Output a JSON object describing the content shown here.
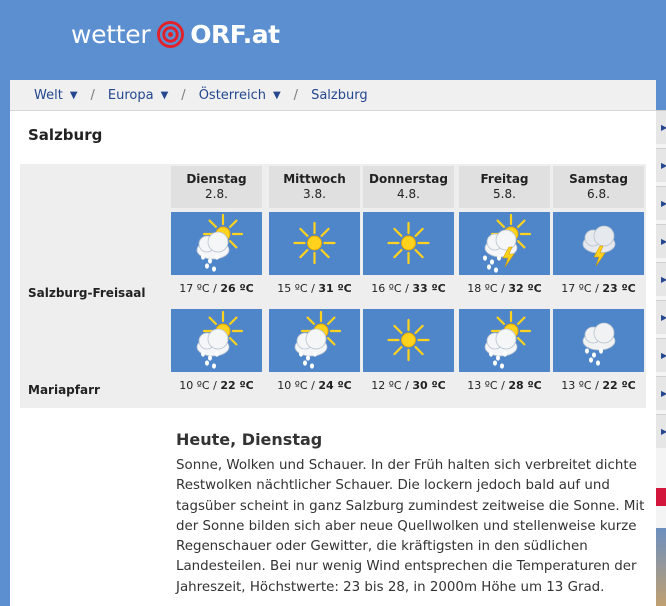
{
  "header": {
    "logo_word": "wetter",
    "logo_brand": "ORF.at"
  },
  "breadcrumb": [
    {
      "label": "Welt",
      "dropdown": true
    },
    {
      "label": "Europa",
      "dropdown": true
    },
    {
      "label": "Österreich",
      "dropdown": true
    },
    {
      "label": "Salzburg",
      "dropdown": false
    }
  ],
  "breadcrumb_separator": "/",
  "breadcrumb_arrow": "▼",
  "city_title": "Salzburg",
  "days": [
    {
      "name": "Dienstag",
      "date": "2.8."
    },
    {
      "name": "Mittwoch",
      "date": "3.8."
    },
    {
      "name": "Donnerstag",
      "date": "4.8."
    },
    {
      "name": "Freitag",
      "date": "5.8."
    },
    {
      "name": "Samstag",
      "date": "6.8."
    }
  ],
  "locations": [
    {
      "name": "Salzburg-Freisaal",
      "forecasts": [
        {
          "icon": "sun-cloud-rain-icon",
          "min": "17 ºC",
          "max": "26 ºC"
        },
        {
          "icon": "sun-icon",
          "min": "15 ºC",
          "max": "31 ºC"
        },
        {
          "icon": "sun-icon",
          "min": "16 ºC",
          "max": "33 ºC"
        },
        {
          "icon": "sun-cloud-thunder-rain-icon",
          "min": "18 ºC",
          "max": "32 ºC"
        },
        {
          "icon": "cloud-thunder-icon",
          "min": "17 ºC",
          "max": "23 ºC"
        }
      ]
    },
    {
      "name": "Mariapfarr",
      "forecasts": [
        {
          "icon": "sun-cloud-rain-icon",
          "min": "10 ºC",
          "max": "22 ºC"
        },
        {
          "icon": "sun-cloud-rain-icon",
          "min": "10 ºC",
          "max": "24 ºC"
        },
        {
          "icon": "sun-icon",
          "min": "12 ºC",
          "max": "30 ºC"
        },
        {
          "icon": "sun-cloud-rain-icon",
          "min": "13 ºC",
          "max": "28 ºC"
        },
        {
          "icon": "cloud-rain-icon",
          "min": "13 ºC",
          "max": "22 ºC"
        }
      ]
    }
  ],
  "today": {
    "heading": "Heute, Dienstag",
    "text": "Sonne, Wolken und Schauer. In der Früh halten sich verbreitet dichte Restwolken nächtlicher Schauer. Die lockern jedoch bald auf und tagsüber scheint in ganz Salzburg zumindest zeitweise die Sonne. Mit der Sonne bilden sich aber neue Quellwolken und stellenweise kurze Regenschauer oder Gewitter, die kräftigsten in den südlichen Landesteilen. Bei nur wenig Wind entsprechen die Temperaturen der Jahreszeit, Höchstwerte: 23 bis 28, in 2000m Höhe um 13 Grad."
  },
  "rail_arrow": "▶",
  "colors": {
    "header_blue": "#5b8fd0",
    "icon_blue": "#4f86c9",
    "link_blue": "#24478f",
    "sun": "#ffd21e"
  }
}
